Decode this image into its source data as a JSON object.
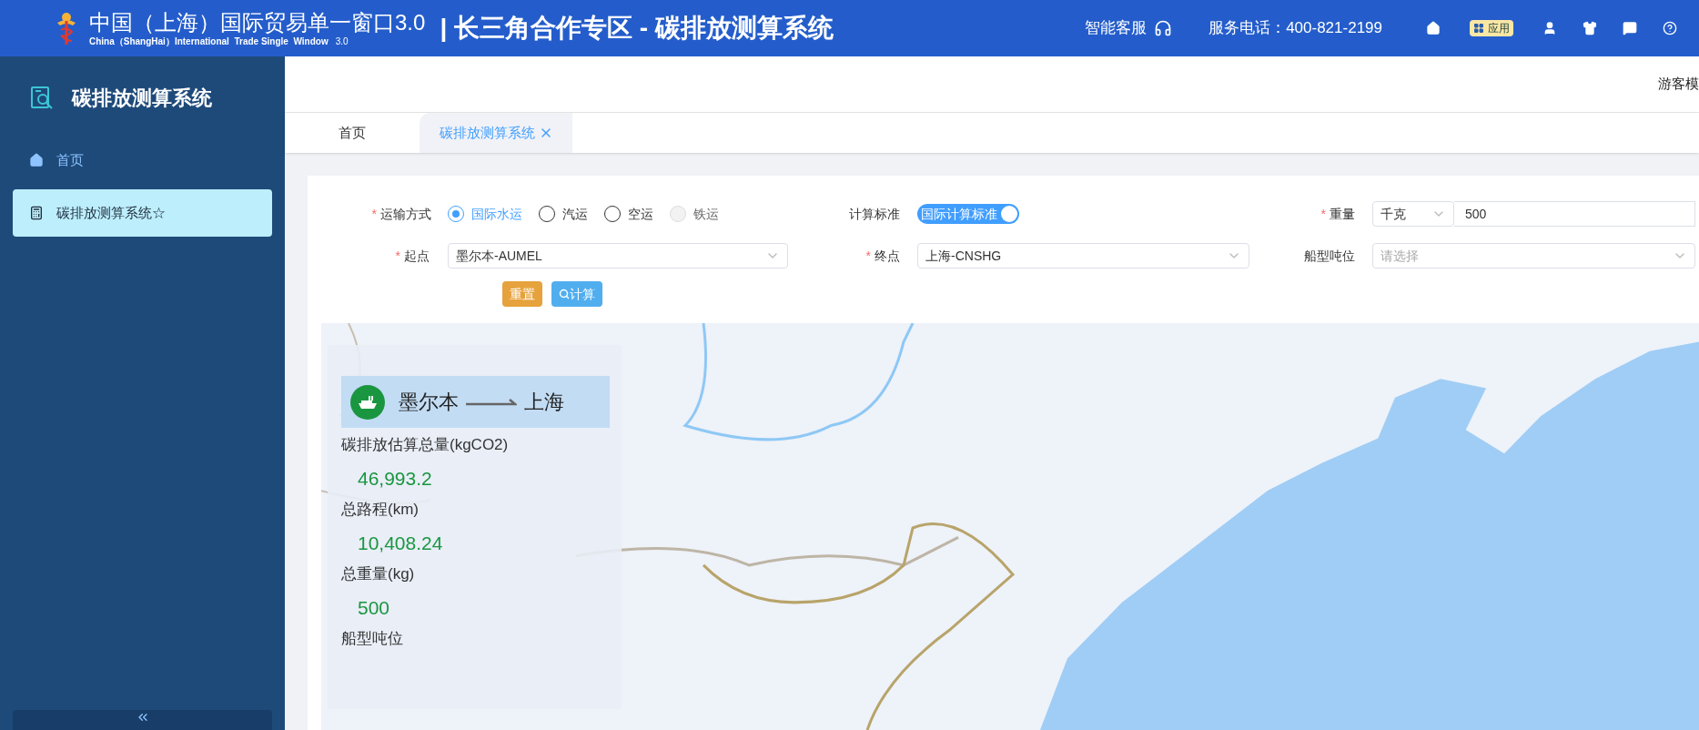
{
  "header": {
    "title": "中国（上海）国际贸易单一窗口3.0",
    "subtitle": "China（ShangHai）International  Trade Single  Window",
    "version": "3.0",
    "zone": "| 长三角合作专区 - 碳排放测算系统",
    "service": "智能客服",
    "phone": "服务电话：400-821-2199",
    "apps_label": "应用"
  },
  "sidebar": {
    "title": "碳排放测算系统",
    "items": [
      {
        "label": "首页",
        "selected": false,
        "kind": "home"
      },
      {
        "label": "碳排放测算系统☆",
        "selected": true,
        "kind": "calculator"
      }
    ]
  },
  "user": "游客模",
  "tabs": [
    {
      "label": "首页",
      "selected": false,
      "closable": false
    },
    {
      "label": "碳排放测算系统",
      "selected": true,
      "closable": true
    }
  ],
  "form": {
    "transport": {
      "label": "运输方式",
      "required_mark": "*",
      "options": [
        {
          "label": "国际水运",
          "selected": true,
          "disabled": false
        },
        {
          "label": "汽运",
          "selected": false,
          "disabled": false
        },
        {
          "label": "空运",
          "selected": false,
          "disabled": false
        },
        {
          "label": "铁运",
          "selected": false,
          "disabled": true
        }
      ]
    },
    "standard": {
      "label": "计算标准",
      "value": "国际计算标准",
      "on": true
    },
    "weight": {
      "label": "重量",
      "required_mark": "*",
      "unit": "千克",
      "value": "500"
    },
    "origin": {
      "label": "起点",
      "required_mark": "*",
      "value": "墨尔本-AUMEL"
    },
    "destination": {
      "label": "终点",
      "required_mark": "*",
      "value": "上海-CNSHG"
    },
    "tonnage": {
      "label": "船型吨位",
      "placeholder": "请选择"
    },
    "buttons": [
      {
        "label": "重置",
        "kind": "reset"
      },
      {
        "label": "计算",
        "kind": "search"
      }
    ]
  },
  "result": {
    "from": "墨尔本",
    "to": "上海",
    "metrics": [
      {
        "label": "碳排放估算总量(kgCO2)",
        "value": "46,993.2"
      },
      {
        "label": "总路程(km)",
        "value": "10,408.24"
      },
      {
        "label": "总重量(kg)",
        "value": "500"
      },
      {
        "label": "船型吨位"
      }
    ]
  }
}
